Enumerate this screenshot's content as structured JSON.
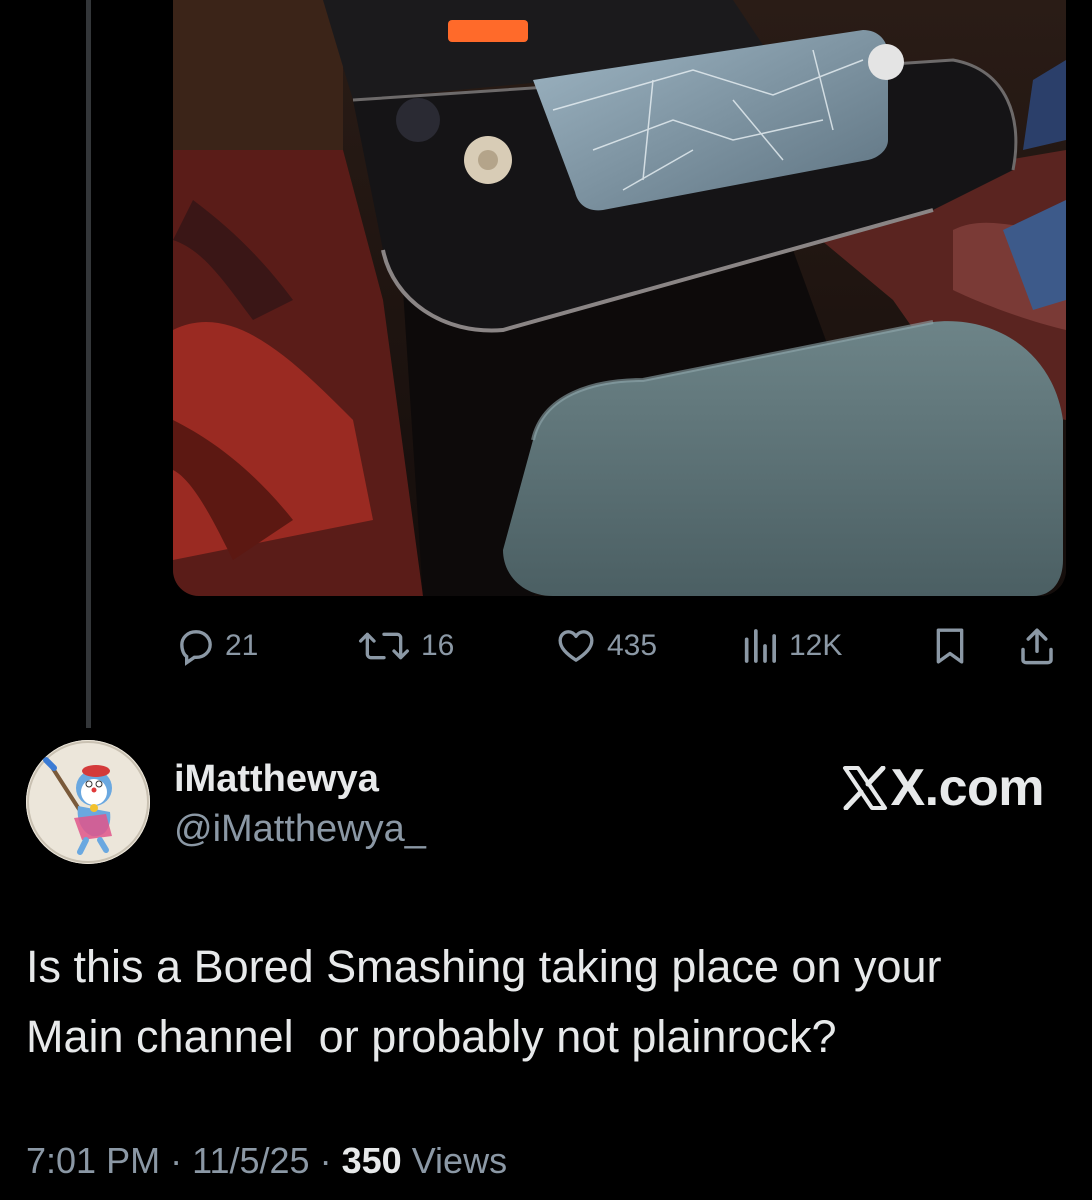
{
  "previous_post": {
    "media_alt": "Photo of a handheld gaming console with a shattered screen resting on a stool",
    "actions": {
      "replies": "21",
      "reposts": "16",
      "likes": "435",
      "views": "12K",
      "icons": {
        "reply": "reply-icon",
        "repost": "repost-icon",
        "like": "heart-icon",
        "views": "analytics-icon",
        "bookmark": "bookmark-icon",
        "share": "share-icon"
      }
    }
  },
  "post": {
    "author": {
      "display_name": "iMatthewya",
      "handle": "@iMatthewya_"
    },
    "watermark": "X.com",
    "text": "Is this a Bored Smashing taking place on your\nMain channel  or probably not plainrock?",
    "time": "7:01 PM",
    "separator": "·",
    "date": "11/5/25",
    "views_count": "350",
    "views_label": "Views"
  },
  "colors": {
    "background": "#000000",
    "text_primary": "#e7e9ea",
    "text_secondary": "#8b98a5",
    "thread_line": "#333639"
  }
}
